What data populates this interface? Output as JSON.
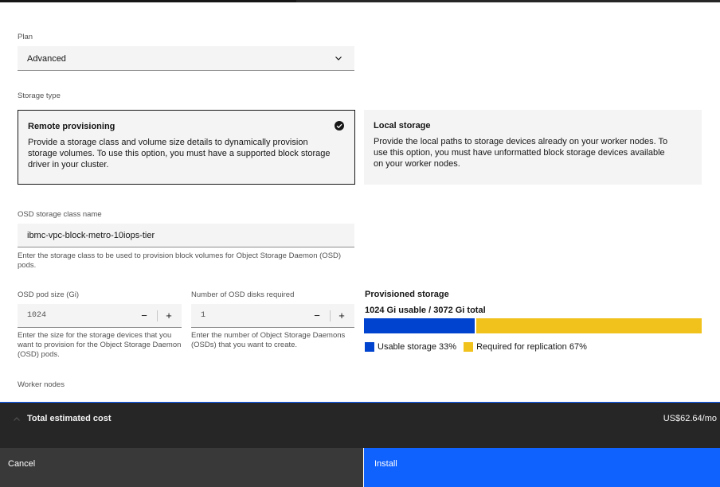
{
  "plan": {
    "label": "Plan",
    "value": "Advanced"
  },
  "storage_type": {
    "label": "Storage type",
    "remote": {
      "title": "Remote provisioning",
      "description": "Provide a storage class and volume size details to dynamically provision storage volumes. To use this option, you must have a supported block storage driver in your cluster.",
      "selected": true
    },
    "local": {
      "title": "Local storage",
      "description": "Provide the local paths to storage devices already on your worker nodes. To use this option, you must have unformatted block storage devices available on your worker nodes.",
      "selected": false
    }
  },
  "osd_class": {
    "label": "OSD storage class name",
    "value": "ibmc-vpc-block-metro-10iops-tier",
    "helper": "Enter the storage class to be used to provision block volumes for Object Storage Daemon (OSD) pods."
  },
  "pod_size": {
    "label": "OSD pod size (Gi)",
    "value": "1024",
    "helper": "Enter the size for the storage devices that you want to provision for the Object Storage Daemon (OSD) pods.",
    "decrement": "−",
    "increment": "+"
  },
  "disks": {
    "label": "Number of OSD disks required",
    "value": "1",
    "helper": "Enter the number of Object Storage Daemons (OSDs) that you want to create.",
    "decrement": "−",
    "increment": "+"
  },
  "provisioned": {
    "title": "Provisioned storage",
    "summary": "1024 Gi usable / 3072 Gi total",
    "usable_fraction": 0.33,
    "legend_usable": "Usable storage 33%",
    "legend_replication": "Required for replication 67%",
    "colors": {
      "usable": "#0043ce",
      "replication": "#f1c21b"
    }
  },
  "worker_nodes": {
    "label": "Worker nodes"
  },
  "cost": {
    "label": "Total estimated cost",
    "value": "US$62.64/mo"
  },
  "actions": {
    "cancel": "Cancel",
    "install": "Install"
  }
}
